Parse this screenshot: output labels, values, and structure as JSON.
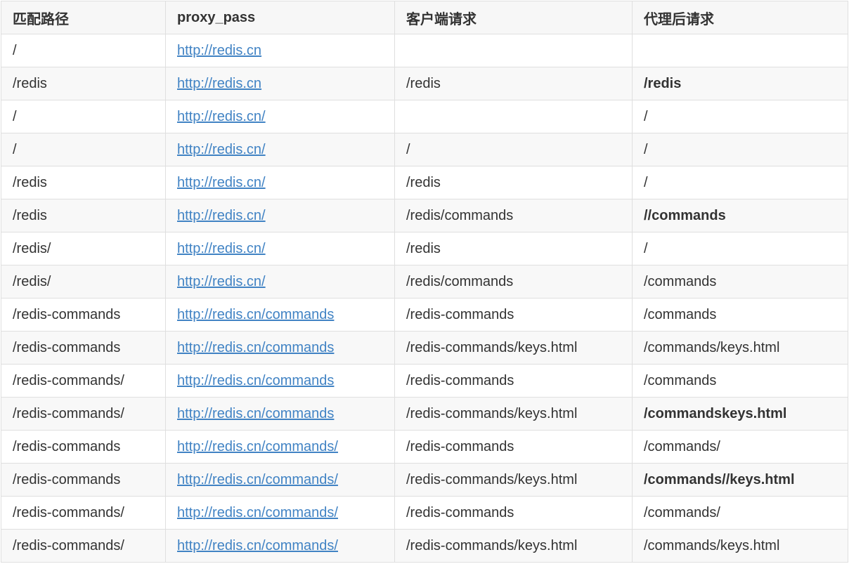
{
  "table": {
    "headers": [
      "匹配路径",
      "proxy_pass",
      "客户端请求",
      "代理后请求"
    ],
    "rows": [
      {
        "match": "/",
        "proxy_pass": "http://redis.cn",
        "client": "",
        "proxied": "",
        "proxied_bold": false
      },
      {
        "match": "/redis",
        "proxy_pass": "http://redis.cn",
        "client": "/redis",
        "proxied": "/redis",
        "proxied_bold": true
      },
      {
        "match": "/",
        "proxy_pass": "http://redis.cn/",
        "client": "",
        "proxied": "/",
        "proxied_bold": false
      },
      {
        "match": "/",
        "proxy_pass": "http://redis.cn/",
        "client": "/",
        "proxied": "/",
        "proxied_bold": false
      },
      {
        "match": "/redis",
        "proxy_pass": "http://redis.cn/",
        "client": "/redis",
        "proxied": "/",
        "proxied_bold": false
      },
      {
        "match": "/redis",
        "proxy_pass": "http://redis.cn/",
        "client": "/redis/commands",
        "proxied": "//commands",
        "proxied_bold": true
      },
      {
        "match": "/redis/",
        "proxy_pass": "http://redis.cn/",
        "client": "/redis",
        "proxied": "/",
        "proxied_bold": false
      },
      {
        "match": "/redis/",
        "proxy_pass": "http://redis.cn/",
        "client": "/redis/commands",
        "proxied": "/commands",
        "proxied_bold": false
      },
      {
        "match": "/redis-commands",
        "proxy_pass": "http://redis.cn/commands",
        "client": "/redis-commands",
        "proxied": "/commands",
        "proxied_bold": false
      },
      {
        "match": "/redis-commands",
        "proxy_pass": "http://redis.cn/commands",
        "client": "/redis-commands/keys.html",
        "proxied": "/commands/keys.html",
        "proxied_bold": false
      },
      {
        "match": "/redis-commands/",
        "proxy_pass": "http://redis.cn/commands",
        "client": "/redis-commands",
        "proxied": "/commands",
        "proxied_bold": false
      },
      {
        "match": "/redis-commands/",
        "proxy_pass": "http://redis.cn/commands",
        "client": "/redis-commands/keys.html",
        "proxied": "/commandskeys.html",
        "proxied_bold": true
      },
      {
        "match": "/redis-commands",
        "proxy_pass": "http://redis.cn/commands/",
        "client": "/redis-commands",
        "proxied": "/commands/",
        "proxied_bold": false
      },
      {
        "match": "/redis-commands",
        "proxy_pass": "http://redis.cn/commands/",
        "client": "/redis-commands/keys.html",
        "proxied": "/commands//keys.html",
        "proxied_bold": true
      },
      {
        "match": "/redis-commands/",
        "proxy_pass": "http://redis.cn/commands/",
        "client": "/redis-commands",
        "proxied": "/commands/",
        "proxied_bold": false
      },
      {
        "match": "/redis-commands/",
        "proxy_pass": "http://redis.cn/commands/",
        "client": "/redis-commands/keys.html",
        "proxied": "/commands/keys.html",
        "proxied_bold": false
      }
    ]
  }
}
